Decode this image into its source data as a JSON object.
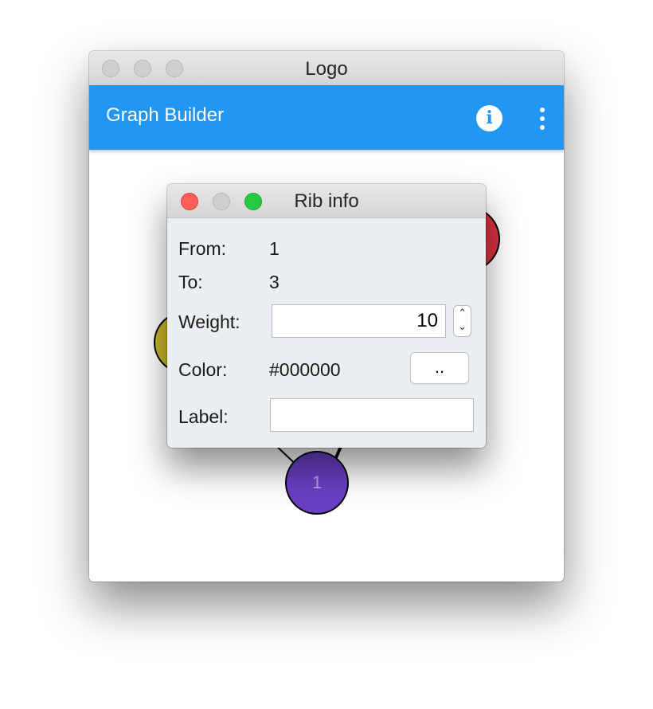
{
  "main_window": {
    "title": "Logo"
  },
  "app_bar": {
    "title": "Graph Builder",
    "info_icon_glyph": "i",
    "info_icon": "info-icon",
    "more_icon": "more-vert-icon",
    "color": "#2196f3"
  },
  "graph": {
    "nodes": [
      {
        "id": "1",
        "label": "1",
        "color": "#6a3fc4"
      },
      {
        "id": "red",
        "label": "",
        "color": "#d9323f"
      },
      {
        "id": "yellow",
        "label": "",
        "color": "#c8b62a"
      }
    ],
    "edges": [
      {
        "from": "1",
        "to": "3",
        "weight": 10,
        "color": "#000000"
      }
    ]
  },
  "dialog": {
    "title": "Rib info",
    "from_label": "From:",
    "from_value": "1",
    "to_label": "To:",
    "to_value": "3",
    "weight_label": "Weight:",
    "weight_value": "10",
    "color_label": "Color:",
    "color_value": "#000000",
    "color_button_label": "..",
    "label_label": "Label:",
    "label_value": ""
  }
}
